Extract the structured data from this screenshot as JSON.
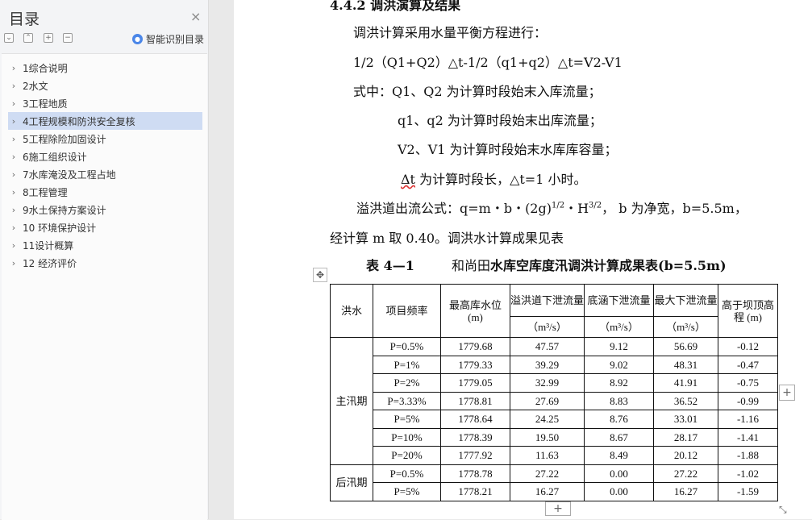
{
  "sidebar": {
    "title": "目录",
    "close_glyph": "×",
    "tools": [
      "⌄",
      "⌃",
      "+",
      "−"
    ],
    "smart_label": "智能识别目录",
    "items": [
      {
        "label": "1综合说明"
      },
      {
        "label": "2水文"
      },
      {
        "label": "3工程地质"
      },
      {
        "label": "4工程规模和防洪安全复核",
        "active": true
      },
      {
        "label": "5工程除险加固设计"
      },
      {
        "label": "6施工组织设计"
      },
      {
        "label": "7水库淹没及工程占地"
      },
      {
        "label": "8工程管理"
      },
      {
        "label": "9水土保持方案设计"
      },
      {
        "label": "10  环境保护设计"
      },
      {
        "label": "11设计概算"
      },
      {
        "label": "12  经济评价"
      }
    ]
  },
  "doc": {
    "heading": "4.4.2  调洪演算及结果",
    "line1": "调洪计算采用水量平衡方程进行：",
    "eq": "1/2（Q1+Q2）△t-1/2（q1+q2）△t=V2-V1",
    "w1": "式中：Q1、Q2 为计算时段始末入库流量；",
    "w2": "q1、q2 为计算时段始末出库流量；",
    "w3": "V2、V1 为计算时段始末水库库容量；",
    "w4_sym": "Δt",
    "w4": " 为计算时段长，△t=1 小时。",
    "spill_a": "溢洪道出流公式：q=m・b・(2g)",
    "spill_sup1": "1/2",
    "spill_b": "・H",
    "spill_sup2": "3/2",
    "spill_c": "， b 为净宽，b=5.5m，",
    "line_m": "经计算 m 取 0.40。调洪水计算成果见表",
    "table_num": "表 4—1",
    "table_prefix": "和尚田",
    "table_bold": "水库空库度汛调洪计算成果表(b=5.5m)",
    "add_glyph": "+",
    "move_glyph": "✥",
    "resize_glyph": "⤡"
  },
  "table": {
    "h_flood": "洪水",
    "h_freq": "项目频率",
    "h_level": "最高库水位\n(m)",
    "h_spill": "溢洪道下泄流量",
    "h_culvert": "底涵下泄流量",
    "h_max": "最大下泄流量",
    "h_above": "高于坝顶高程 (m)",
    "unit": "（m³/s）",
    "groups": [
      {
        "name": "主汛期",
        "rows": [
          [
            "P=0.5%",
            "1779.68",
            "47.57",
            "9.12",
            "56.69",
            "-0.12"
          ],
          [
            "P=1%",
            "1779.33",
            "39.29",
            "9.02",
            "48.31",
            "-0.47"
          ],
          [
            "P=2%",
            "1779.05",
            "32.99",
            "8.92",
            "41.91",
            "-0.75"
          ],
          [
            "P=3.33%",
            "1778.81",
            "27.69",
            "8.83",
            "36.52",
            "-0.99"
          ],
          [
            "P=5%",
            "1778.64",
            "24.25",
            "8.76",
            "33.01",
            "-1.16"
          ],
          [
            "P=10%",
            "1778.39",
            "19.50",
            "8.67",
            "28.17",
            "-1.41"
          ],
          [
            "P=20%",
            "1777.92",
            "11.63",
            "8.49",
            "20.12",
            "-1.88"
          ]
        ]
      },
      {
        "name": "后汛期",
        "rows": [
          [
            "P=0.5%",
            "1778.78",
            "27.22",
            "0.00",
            "27.22",
            "-1.02"
          ],
          [
            "P=5%",
            "1778.21",
            "16.27",
            "0.00",
            "16.27",
            "-1.59"
          ]
        ]
      }
    ]
  }
}
